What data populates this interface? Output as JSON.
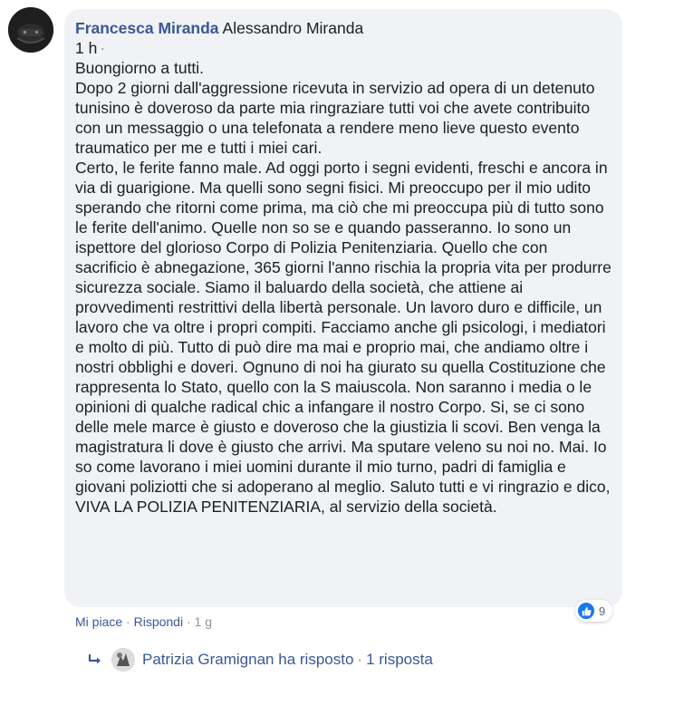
{
  "comment": {
    "author": "Francesca Miranda",
    "tagged_user": "Alessandro Miranda",
    "timestamp": "1 h",
    "timestamp_separator": "·",
    "paragraphs": [
      "Buongiorno a tutti.",
      "Dopo 2 giorni dall'aggressione ricevuta in servizio ad opera di un detenuto tunisino è doveroso da parte mia ringraziare tutti voi che avete contribuito con un messaggio o una telefonata a rendere meno lieve questo evento traumatico per me e tutti i miei cari.",
      "Certo, le ferite fanno male. Ad oggi porto i segni evidenti, freschi e ancora in via di guarigione. Ma quelli sono segni fisici. Mi preoccupo per il mio udito sperando che ritorni come prima, ma ciò che mi preoccupa più di tutto sono le ferite dell'animo. Quelle non so se e quando passeranno. Io sono un ispettore del glorioso Corpo di Polizia Penitenziaria. Quello che con sacrificio è abnegazione, 365 giorni l'anno rischia la propria vita per produrre sicurezza sociale. Siamo il baluardo della società, che attiene ai provvedimenti restrittivi della libertà personale. Un lavoro duro e difficile, un lavoro che va oltre i propri compiti. Facciamo anche gli psicologi, i mediatori e molto di più. Tutto di può dire ma mai e proprio mai, che andiamo oltre i nostri obblighi e doveri. Ognuno di noi ha giurato su quella Costituzione che rappresenta lo Stato, quello con la S maiuscola. Non saranno i media o le opinioni di qualche radical chic a infangare il nostro Corpo. Si, se ci sono delle mele marce è giusto e doveroso che la giustizia li scovi. Ben venga la magistratura li dove è giusto che arrivi. Ma sputare veleno su noi no. Mai. Io so come lavorano i miei uomini durante il mio turno, padri di famiglia e giovani poliziotti che si adoperano al meglio. Saluto tutti e vi ringrazio e dico, VIVA LA POLIZIA PENITENZIARIA, al servizio della società."
    ],
    "reactions": {
      "icon": "like-icon",
      "count": "9",
      "color": "#1877f2"
    },
    "actions": {
      "like_label": "Mi piace",
      "reply_label": "Rispondi",
      "age": "1 g",
      "separator": "·"
    },
    "replies": {
      "icon": "reply-arrow-icon",
      "replier": "Patrizia Gramignan",
      "replied_text": "ha risposto",
      "separator": "·",
      "count_label": "1 risposta"
    }
  },
  "colors": {
    "link": "#385898",
    "bubble_bg": "#f0f2f5",
    "text": "#1c1e21",
    "muted": "#90949c"
  }
}
